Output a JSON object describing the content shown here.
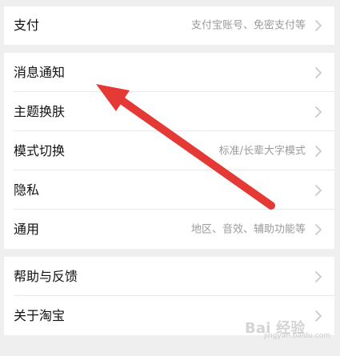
{
  "settings": {
    "payment": {
      "label": "支付",
      "detail": "支付宝账号、免密支付等"
    },
    "notifications": {
      "label": "消息通知"
    },
    "theme": {
      "label": "主题换肤"
    },
    "mode": {
      "label": "模式切换",
      "detail": "标准/长辈大字模式"
    },
    "privacy": {
      "label": "隐私"
    },
    "general": {
      "label": "通用",
      "detail": "地区、音效、辅助功能等"
    },
    "help": {
      "label": "帮助与反馈"
    },
    "about": {
      "label": "关于淘宝"
    }
  },
  "watermark": {
    "text": "Bai 经验",
    "subtext": "jingyan.baidu.com"
  },
  "colors": {
    "background": "#efefef",
    "card": "#ffffff",
    "primary_text": "#111111",
    "secondary_text": "#9b9b9b",
    "divider": "#e9e9e9",
    "annotation_arrow": "#e53935"
  },
  "icons": {
    "row_chevron": "chevron-right-icon",
    "annotation": "red-arrow"
  }
}
